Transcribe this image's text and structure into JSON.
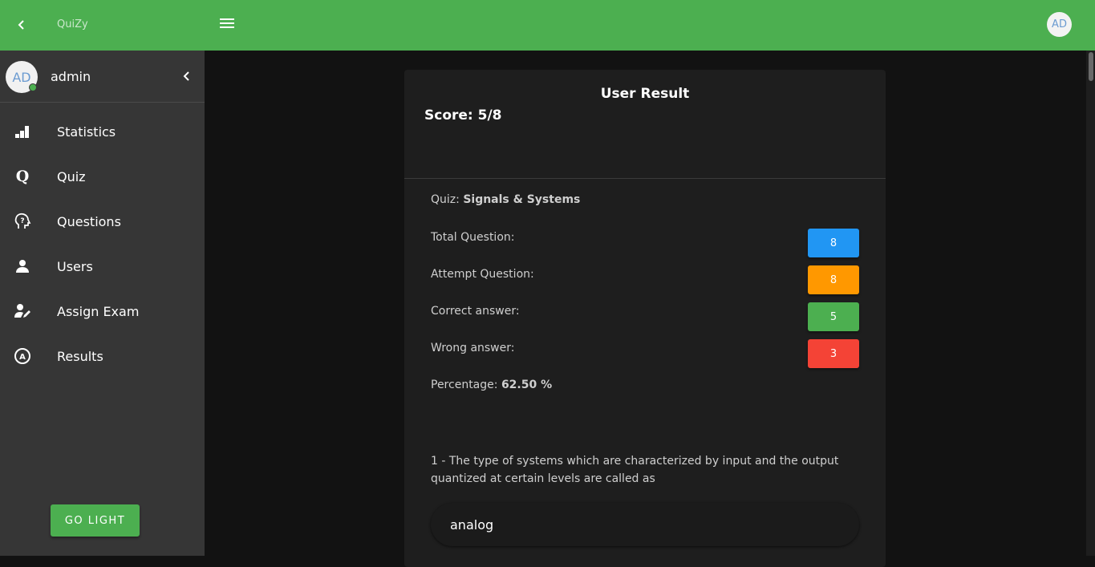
{
  "app": {
    "title": "QuiZy",
    "avatar_initials": "AD"
  },
  "sidebar": {
    "user": {
      "initials": "AD",
      "name": "admin"
    },
    "items": [
      {
        "label": "Statistics",
        "icon": "bar-chart-icon"
      },
      {
        "label": "Quiz",
        "icon": "quiz-q-icon"
      },
      {
        "label": "Questions",
        "icon": "question-head-icon"
      },
      {
        "label": "Users",
        "icon": "user-icon"
      },
      {
        "label": "Assign Exam",
        "icon": "user-edit-icon"
      },
      {
        "label": "Results",
        "icon": "results-circle-icon"
      }
    ],
    "theme_button": "GO LIGHT"
  },
  "result": {
    "title": "User Result",
    "score": "Score: 5/8",
    "quiz_label": "Quiz:",
    "quiz_name": "Signals & Systems",
    "stats": [
      {
        "label": "Total Question:",
        "value": "8",
        "color": "#2196f3"
      },
      {
        "label": "Attempt Question:",
        "value": "8",
        "color": "#ff9800"
      },
      {
        "label": "Correct answer:",
        "value": "5",
        "color": "#4caf50"
      },
      {
        "label": "Wrong answer:",
        "value": "3",
        "color": "#f44336"
      }
    ],
    "percentage_label": "Percentage:",
    "percentage_value": "62.50 %",
    "question": "1 - The type of systems which are characterized by input and the output quantized at certain levels are called as",
    "answer": "analog"
  },
  "colors": {
    "primary": "#4caf50",
    "sidebar": "#363636",
    "card": "#1e1e1e",
    "background": "#121212"
  }
}
